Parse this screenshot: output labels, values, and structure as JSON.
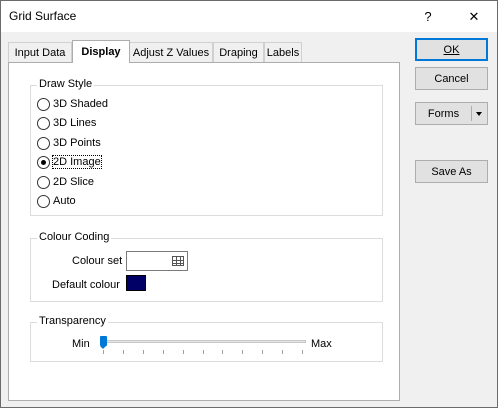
{
  "window": {
    "title": "Grid Surface",
    "help_glyph": "?",
    "close_glyph": "✕"
  },
  "tabs": [
    {
      "label": "Input Data",
      "active": false
    },
    {
      "label": "Display",
      "active": true
    },
    {
      "label": "Adjust Z Values",
      "active": false
    },
    {
      "label": "Draping",
      "active": false
    },
    {
      "label": "Labels",
      "active": false
    }
  ],
  "draw_style": {
    "title": "Draw Style",
    "options": [
      "3D Shaded",
      "3D Lines",
      "3D Points",
      "2D Image",
      "2D Slice",
      "Auto"
    ],
    "selected": "2D Image"
  },
  "colour_coding": {
    "title": "Colour Coding",
    "colour_set_label": "Colour set",
    "colour_set_value": "",
    "default_colour_label": "Default colour",
    "default_colour": "#000066"
  },
  "transparency": {
    "title": "Transparency",
    "min_label": "Min",
    "max_label": "Max",
    "value_fraction": 0.0,
    "tick_count": 11
  },
  "buttons": {
    "ok": "OK",
    "cancel": "Cancel",
    "forms": "Forms",
    "save_as": "Save As"
  }
}
